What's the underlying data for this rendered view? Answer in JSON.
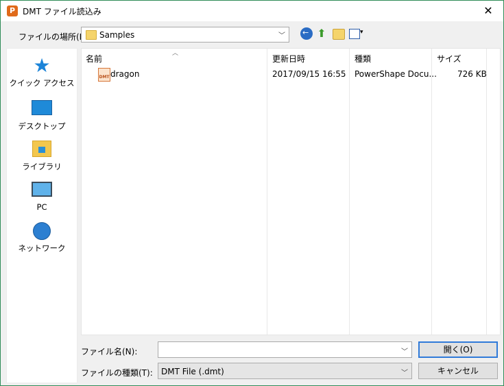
{
  "window": {
    "title": "DMT ファイル読込み",
    "app_icon_letter": "P",
    "close_glyph": "✕"
  },
  "look_in": {
    "label": "ファイルの場所(I):",
    "value": "Samples"
  },
  "toolbar": {
    "back_glyph": "",
    "up_glyph": "⬆",
    "view_arrow": "▾"
  },
  "places": [
    {
      "name": "クイック アクセス",
      "icon": "quick-access-star"
    },
    {
      "name": "デスクトップ",
      "icon": "desktop"
    },
    {
      "name": "ライブラリ",
      "icon": "library"
    },
    {
      "name": "PC",
      "icon": "pc"
    },
    {
      "name": "ネットワーク",
      "icon": "network"
    }
  ],
  "file_list": {
    "columns": [
      "名前",
      "更新日時",
      "種類",
      "サイズ"
    ],
    "rows": [
      {
        "name": "dragon",
        "modified": "2017/09/15 16:55",
        "type": "PowerShape Docu...",
        "size": "726 KB",
        "icon_label": "DMT"
      }
    ]
  },
  "file_name": {
    "label": "ファイル名(N):",
    "value": ""
  },
  "file_type": {
    "label": "ファイルの種類(T):",
    "value": "DMT File (.dmt)"
  },
  "buttons": {
    "open": "開く(O)",
    "cancel": "キャンセル"
  },
  "colors": {
    "accent": "#2f7ad9",
    "border": "#2e8b57"
  }
}
